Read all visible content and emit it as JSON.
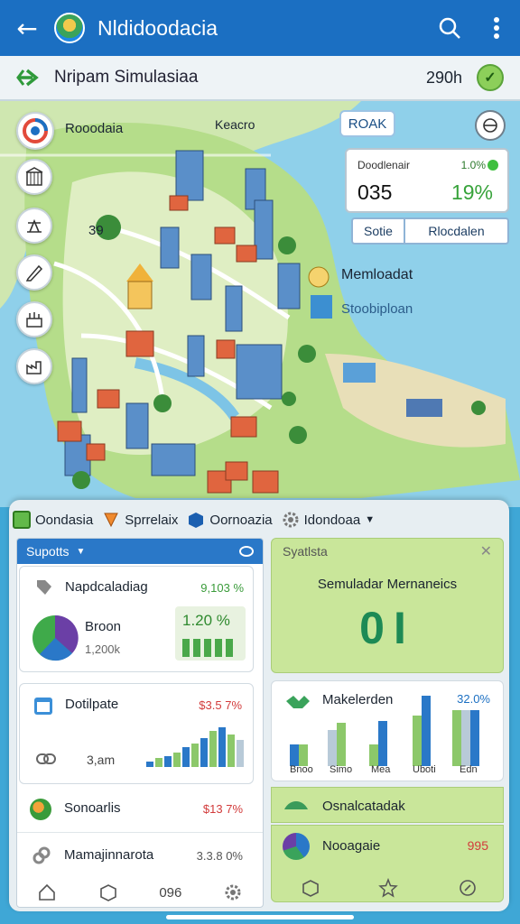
{
  "appbar": {
    "title": "Nldidoodacia",
    "back_icon": "arrow-left-icon",
    "search_icon": "search-icon",
    "menu_icon": "more-vertical-icon"
  },
  "subbar": {
    "name": "Nripam Simulasiaa",
    "time": "290h",
    "status_icon": "check-icon"
  },
  "map": {
    "label_top_left": "Rooodaia",
    "label_top": "Keacro",
    "label_left_mid": "39",
    "label_center": "Memloadat",
    "label_center_sub": "Stoobiploan",
    "roak_button": "ROAK",
    "stat_card": {
      "label": "Doodlenair",
      "label_pct": "1.0%",
      "value": "035",
      "value_pct": "19%"
    },
    "segments": [
      "Sotie",
      "Rlocdalen"
    ]
  },
  "tabs": [
    {
      "label": "Oondasia",
      "icon": "grid-icon"
    },
    {
      "label": "Sprrelaix",
      "icon": "tag-icon"
    },
    {
      "label": "Oornoazia",
      "icon": "cube-icon"
    },
    {
      "label": "Idondoaa",
      "icon": "gear-icon"
    }
  ],
  "left_panel": {
    "header": "Supotts",
    "card1": {
      "title": "Napdcaladiag",
      "pct": "9,103 %",
      "sub_label": "Broon",
      "sub_value": "1,200k",
      "chart_value": "1.20 %"
    },
    "card2": {
      "title": "Dotilpate",
      "pct": "$3.5 7%",
      "sub_value": "3,am"
    },
    "row3": {
      "title": "Sonoarlis",
      "pct": "$13 7%"
    },
    "row4": {
      "title": "Mamajinnarota",
      "pct": "3.3.8 0%"
    },
    "nav_label": "096"
  },
  "right_panel": {
    "header": "Syatlsta",
    "big_title": "Semuladar Mernaneics",
    "big_value": "0I",
    "chart": {
      "title": "Makelerden",
      "pct": "32.0%",
      "categories": [
        "Bnoo",
        "Simo",
        "Mea",
        "Uboti",
        "Edn"
      ]
    },
    "row1": "Osnalcatadak",
    "row2": {
      "title": "Nooagaie",
      "value": "995"
    }
  },
  "colors": {
    "primary": "#1b6fc2",
    "accent_green": "#3fae3f",
    "accent_red": "#d23b3b",
    "bar_blue": "#2a78c8",
    "bar_green": "#8cc86a"
  }
}
